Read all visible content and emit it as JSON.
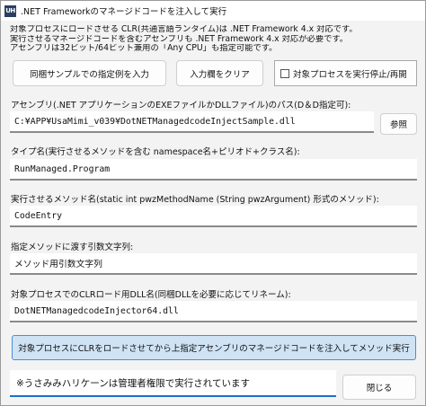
{
  "window": {
    "icon_text": "UH",
    "title": ".NET Frameworkのマネージドコードを注入して実行"
  },
  "description": {
    "line1": "対象プロセスにロードさせる CLR(共通言語ランタイム)は .NET Framework 4.x 対応です。",
    "line2": "実行させるマネージドコードを含むアセンブリも .NET Framework 4.x 対応が必要です。",
    "line3": "アセンブリは32ビット/64ビット兼用の「Any CPU」も指定可能です。"
  },
  "toolbar": {
    "sample_label": "同梱サンプルでの指定例を入力",
    "clear_label": "入力欄をクリア",
    "pause_label": "対象プロセスを実行停止/再開"
  },
  "assembly": {
    "label": "アセンブリ(.NET アプリケーションのEXEファイルかDLLファイル)のパス(D＆D指定可):",
    "value": "C:¥APP¥UsaMimi_v039¥DotNETManagedcodeInjectSample.dll",
    "browse_label": "参照"
  },
  "type_name": {
    "label": "タイプ名(実行させるメソッドを含む namespace名+ピリオド+クラス名):",
    "value": "RunManaged.Program"
  },
  "method_name": {
    "label": "実行させるメソッド名(static int pwzMethodName (String pwzArgument) 形式のメソッド):",
    "value": "CodeEntry"
  },
  "argument": {
    "label": "指定メソッドに渡す引数文字列:",
    "value": "メソッド用引数文字列"
  },
  "dll_name": {
    "label": "対象プロセスでのCLRロード用DLL名(同梱DLLを必要に応じてリネーム):",
    "value": "DotNETManagedcodeInjector64.dll"
  },
  "inject_button": {
    "label": "対象プロセスにCLRをロードさせてから上指定アセンブリのマネージドコードを注入してメソッド実行"
  },
  "status": {
    "text": "※うさみみハリケーンは管理者権限で実行されています"
  },
  "close_button": {
    "label": "閉じる"
  }
}
